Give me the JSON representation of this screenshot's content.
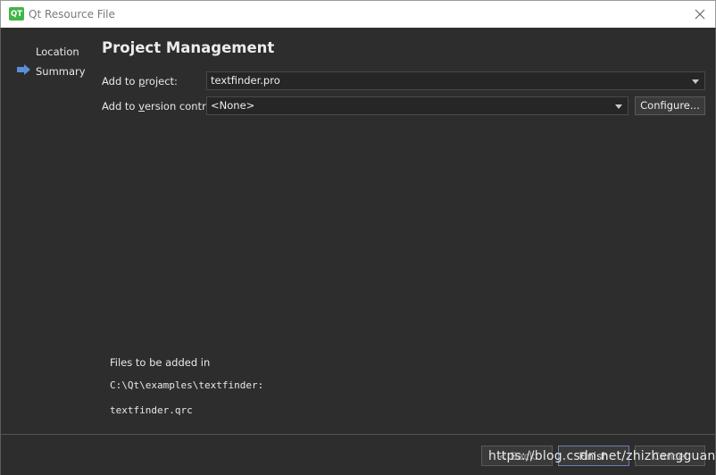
{
  "window": {
    "logo_text": "QT",
    "title": "Qt Resource File"
  },
  "sidebar": {
    "items": [
      {
        "label": "Location"
      },
      {
        "label": "Summary",
        "current": true
      }
    ]
  },
  "page": {
    "title": "Project Management"
  },
  "form": {
    "project_label_pre": "Add to ",
    "project_label_u": "p",
    "project_label_post": "roject:",
    "project_value": "textfinder.pro",
    "vc_label_pre": "Add to ",
    "vc_label_u": "v",
    "vc_label_post": "ersion control:",
    "vc_value": "<None>",
    "configure_label": "Configure..."
  },
  "files": {
    "title": "Files to be added in",
    "path": "C:\\Qt\\examples\\textfinder:",
    "items": [
      "textfinder.qrc"
    ]
  },
  "footer": {
    "back_label": "< Back",
    "finish_label": "Finish",
    "cancel_label": "Cancel"
  },
  "watermark": "https://blog.csdn.net/zhizhengguan",
  "colors": {
    "background": "#2d2d2d",
    "qt_green": "#41b649",
    "nav_arrow": "#5b8ed8"
  }
}
